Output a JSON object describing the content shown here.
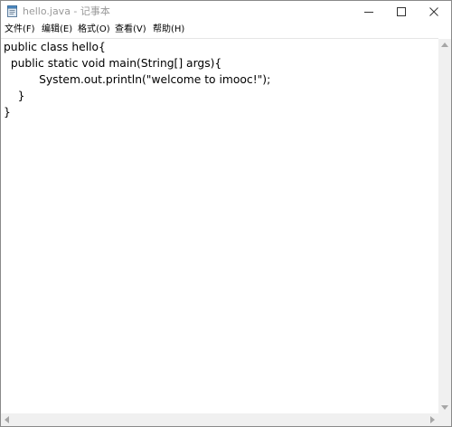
{
  "window": {
    "title": "hello.java - 记事本",
    "app_icon": "notepad-icon"
  },
  "controls": {
    "minimize_icon": "minimize-icon",
    "maximize_icon": "maximize-icon",
    "close_icon": "close-icon"
  },
  "menu": {
    "items": [
      {
        "label": "文件(F)"
      },
      {
        "label": "编辑(E)"
      },
      {
        "label": "格式(O)"
      },
      {
        "label": "查看(V)"
      },
      {
        "label": "帮助(H)"
      }
    ]
  },
  "editor": {
    "lines": [
      "public class hello{",
      "  public static void main(String[] args){",
      "          System.out.println(\"welcome to imooc!\");",
      "    }",
      "}"
    ]
  },
  "colors": {
    "title_text": "#9a9a9a",
    "text": "#000000",
    "scrollbar": "#f0f0f0"
  }
}
